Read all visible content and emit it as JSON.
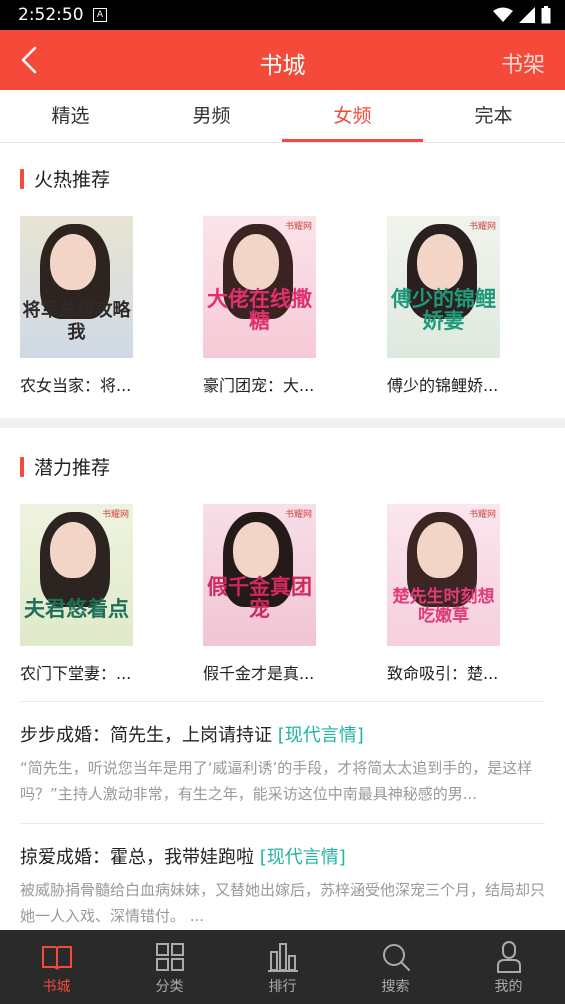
{
  "status_bar": {
    "time": "2:52:50",
    "notification_glyph": "A"
  },
  "app_bar": {
    "title": "书城",
    "right_action": "书架"
  },
  "tabs": [
    {
      "label": "精选",
      "active": false
    },
    {
      "label": "男频",
      "active": false
    },
    {
      "label": "女频",
      "active": true
    },
    {
      "label": "完本",
      "active": false
    }
  ],
  "hot_section": {
    "title": "火热推荐",
    "books": [
      {
        "title": "农女当家：将...",
        "cover_text": "将军总想攻略我"
      },
      {
        "title": "豪门团宠：大...",
        "cover_text": "大佬在线撒糖"
      },
      {
        "title": "傅少的锦鲤娇...",
        "cover_text": "傅少的锦鲤娇妻"
      }
    ]
  },
  "potential_section": {
    "title": "潜力推荐",
    "books": [
      {
        "title": "农门下堂妻：...",
        "cover_text": "夫君悠着点"
      },
      {
        "title": "假千金才是真...",
        "cover_text": "假千金真团宠"
      },
      {
        "title": "致命吸引：楚...",
        "cover_text": "楚先生时刻想吃嫩草"
      }
    ]
  },
  "list_items": [
    {
      "title": "步步成婚：简先生，上岗请持证",
      "tag": "[现代言情]",
      "description": "“简先生，听说您当年是用了‘威逼利诱’的手段，才将简太太追到手的，是这样吗？”主持人激动非常，有生之年，能采访这位中南最具神秘感的男..."
    },
    {
      "title": "掠爱成婚：霍总，我带娃跑啦",
      "tag": "[现代言情]",
      "description": "被威胁捐骨髓给白血病妹妹，又替她出嫁后，苏梓涵受他深宠三个月，结局却只她一人入戏、深情错付。 ..."
    }
  ],
  "bottom_nav": [
    {
      "label": "书城",
      "icon": "book-icon",
      "active": true
    },
    {
      "label": "分类",
      "icon": "grid-icon",
      "active": false
    },
    {
      "label": "排行",
      "icon": "bar-chart-icon",
      "active": false
    },
    {
      "label": "搜索",
      "icon": "search-icon",
      "active": false
    },
    {
      "label": "我的",
      "icon": "user-icon",
      "active": false
    }
  ],
  "colors": {
    "accent": "#f5493a",
    "tag": "#1fb5a0",
    "nav_bg": "#2a2a2a"
  }
}
